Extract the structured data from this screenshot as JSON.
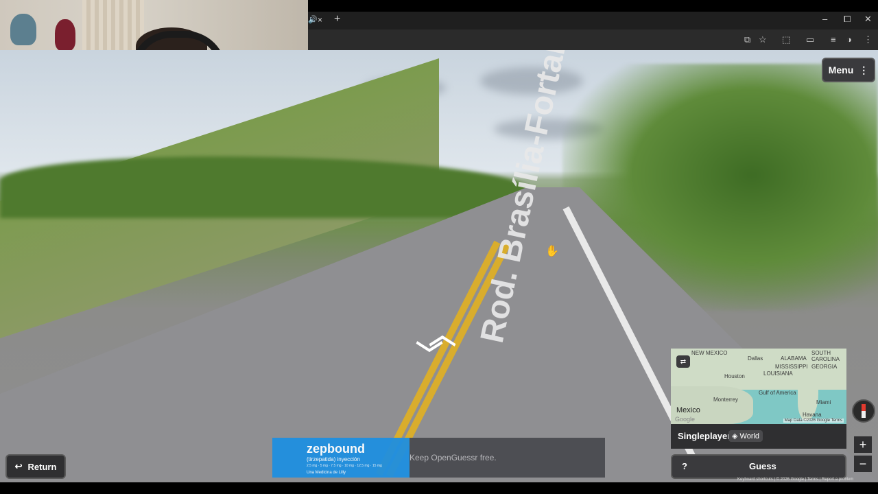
{
  "browser": {
    "audio_icon": "speaker-icon",
    "tab_close": "×",
    "new_tab": "+",
    "window_controls": {
      "minimize": "–",
      "maximize": "⧠",
      "close": "✕"
    },
    "toolbar_icons": [
      "translate-icon",
      "star-icon",
      "extensions-icon",
      "cast-icon",
      "media-icon",
      "profile-icon",
      "more-icon"
    ]
  },
  "streetview": {
    "road_label": "Rod. Brasília-Fortaleza",
    "nav_arrow_forward": "︿",
    "nav_arrow_back": "﹀"
  },
  "hud": {
    "menu_label": "Menu",
    "return_label": "Return"
  },
  "ad": {
    "brand": "zepbound",
    "subtitle": "(tirzepatida) inyección",
    "fine": "2.5 mg · 5 mg · 7.5 mg · 10 mg · 12.5 mg · 15 mg",
    "maker": "Una Medicina de Lilly",
    "text": "Keep OpenGuessr free."
  },
  "map": {
    "labels": {
      "new_mexico": "NEW MEXICO",
      "dallas": "Dallas",
      "alabama": "ALABAMA",
      "south_carolina": "SOUTH CAROLINA",
      "mississippi": "MISSISSIPPI",
      "georgia": "GEORGIA",
      "louisiana": "LOUISIANA",
      "houston": "Houston",
      "gulf": "Gulf of America",
      "monterrey": "Monterrey",
      "miami": "Miami",
      "mexico": "Mexico",
      "havana": "Havana"
    },
    "google": "Google",
    "attribution": "Map Data ©2026 Google   Terms"
  },
  "mode": {
    "singleplayer": "Singleplayer",
    "world": "World"
  },
  "guess": {
    "help": "?",
    "label": "Guess"
  },
  "zoom": {
    "in": "+",
    "out": "−"
  },
  "footer": "Keyboard shortcuts  |  © 2026 Google  |  Terms  |  Report a problem"
}
